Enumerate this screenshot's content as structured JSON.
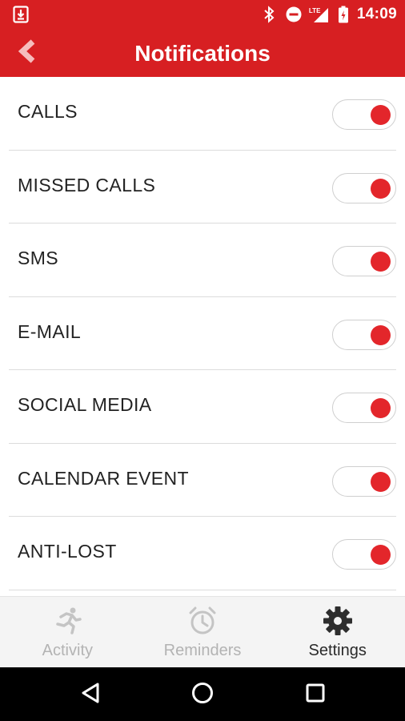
{
  "status_bar": {
    "time": "14:09",
    "network_label": "LTE",
    "icons": [
      "download-icon",
      "bluetooth-icon",
      "do-not-disturb-icon",
      "signal-icon",
      "battery-charging-icon"
    ]
  },
  "header": {
    "title": "Notifications",
    "back_icon": "chevron-left-icon"
  },
  "notifications": {
    "items": [
      {
        "label": "CALLS",
        "enabled": true
      },
      {
        "label": "MISSED CALLS",
        "enabled": true
      },
      {
        "label": "SMS",
        "enabled": true
      },
      {
        "label": "E-MAIL",
        "enabled": true
      },
      {
        "label": "SOCIAL MEDIA",
        "enabled": true
      },
      {
        "label": "CALENDAR EVENT",
        "enabled": true
      },
      {
        "label": "ANTI-LOST",
        "enabled": true
      }
    ]
  },
  "bottom_nav": {
    "items": [
      {
        "label": "Activity",
        "icon": "running-person-icon",
        "active": false
      },
      {
        "label": "Reminders",
        "icon": "alarm-clock-icon",
        "active": false
      },
      {
        "label": "Settings",
        "icon": "gear-icon",
        "active": true
      }
    ]
  },
  "system_nav": {
    "icons": [
      "back-triangle-icon",
      "home-circle-icon",
      "recents-square-icon"
    ]
  },
  "colors": {
    "brand_red": "#d71f22",
    "toggle_knob": "#e3262b",
    "inactive_nav": "#b3b3b3",
    "active_nav": "#2a2a2a"
  }
}
